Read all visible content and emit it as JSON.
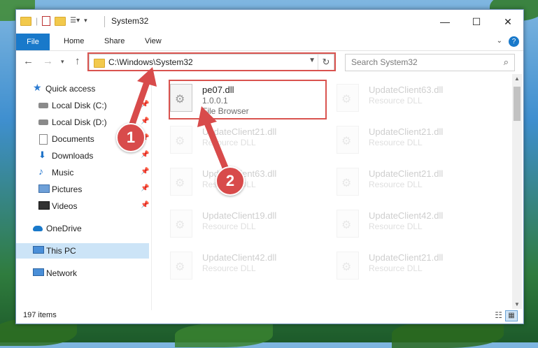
{
  "window": {
    "title": "System32"
  },
  "ribbon": {
    "file": "File",
    "home": "Home",
    "share": "Share",
    "view": "View"
  },
  "address": {
    "path": "C:\\Windows\\System32"
  },
  "search": {
    "placeholder": "Search System32"
  },
  "sidebar": {
    "items": [
      {
        "label": "Quick access",
        "icon": "star-icon"
      },
      {
        "label": "Local Disk (C:)",
        "icon": "drive-icon"
      },
      {
        "label": "Local Disk (D:)",
        "icon": "drive-icon"
      },
      {
        "label": "Documents",
        "icon": "documents-icon"
      },
      {
        "label": "Downloads",
        "icon": "download-icon"
      },
      {
        "label": "Music",
        "icon": "music-icon"
      },
      {
        "label": "Pictures",
        "icon": "pictures-icon"
      },
      {
        "label": "Videos",
        "icon": "videos-icon"
      },
      {
        "label": "OneDrive",
        "icon": "onedrive-icon"
      },
      {
        "label": "This PC",
        "icon": "computer-icon"
      },
      {
        "label": "Network",
        "icon": "network-icon"
      }
    ]
  },
  "files": [
    {
      "name": "pe07.dll",
      "version": "1.0.0.1",
      "desc": "File Browser"
    },
    {
      "name": "UpdateClient63.dll",
      "desc": "Resource DLL"
    },
    {
      "name": "UpdateClient21.dll",
      "desc": "Resource DLL"
    },
    {
      "name": "UpdateClient21.dll",
      "desc": "Resource DLL"
    },
    {
      "name": "UpdateClient63.dll",
      "desc": "Resource DLL"
    },
    {
      "name": "UpdateClient21.dll",
      "desc": "Resource DLL"
    },
    {
      "name": "UpdateClient19.dll",
      "desc": "Resource DLL"
    },
    {
      "name": "UpdateClient42.dll",
      "desc": "Resource DLL"
    },
    {
      "name": "UpdateClient42.dll",
      "desc": "Resource DLL"
    },
    {
      "name": "UpdateClient21.dll",
      "desc": "Resource DLL"
    }
  ],
  "status": {
    "count": "197 items"
  },
  "annotations": {
    "step1": "1",
    "step2": "2"
  },
  "colors": {
    "accent": "#1979ca",
    "highlight": "#d9534f",
    "selected": "#cce4f7"
  }
}
